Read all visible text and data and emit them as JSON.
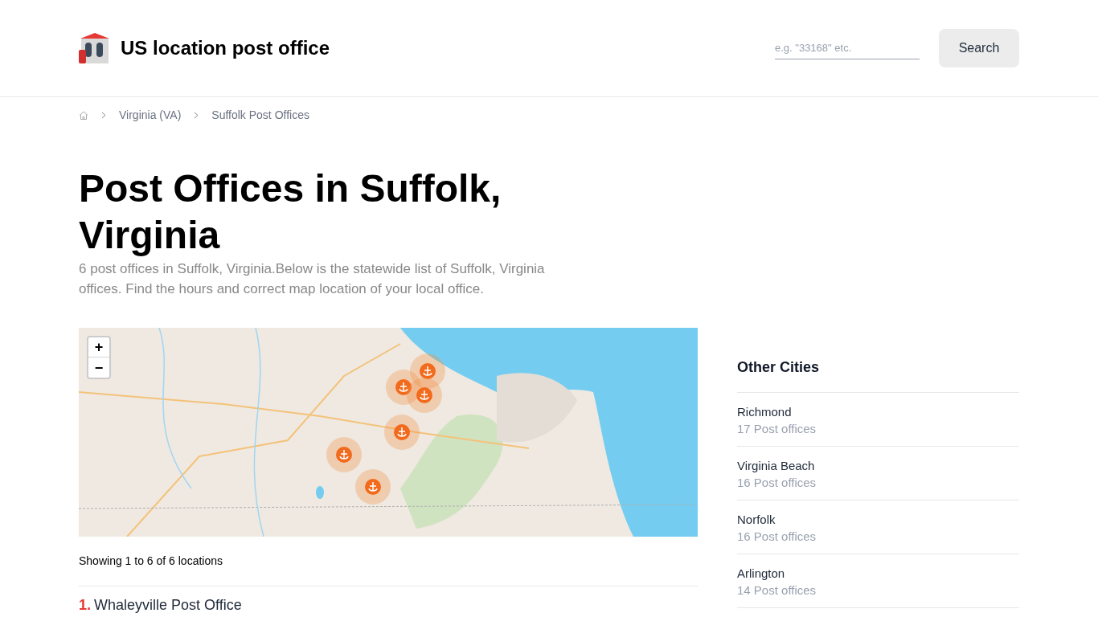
{
  "header": {
    "site_title": "US location post office",
    "search": {
      "placeholder": "e.g. \"33168\" etc."
    },
    "search_button": "Search"
  },
  "breadcrumb": [
    "Virginia (VA)",
    "Suffolk Post Offices"
  ],
  "page": {
    "title": "Post Offices in Suffolk, Virginia",
    "description": "6 post offices in Suffolk, Virginia.Below is the statewide list of Suffolk, Virginia offices. Find the hours and correct map location of your local office."
  },
  "map": {
    "zoom_in": "+",
    "zoom_out": "−"
  },
  "results": {
    "summary": "Showing 1 to 6 of 6 locations",
    "items": [
      {
        "number": "1.",
        "name": "Whaleyville Post Office"
      }
    ]
  },
  "sidebar": {
    "heading": "Other Cities",
    "cities": [
      {
        "name": "Richmond",
        "count": "17 Post offices"
      },
      {
        "name": "Virginia Beach",
        "count": "16 Post offices"
      },
      {
        "name": "Norfolk",
        "count": "16 Post offices"
      },
      {
        "name": "Arlington",
        "count": "14 Post offices"
      }
    ]
  }
}
